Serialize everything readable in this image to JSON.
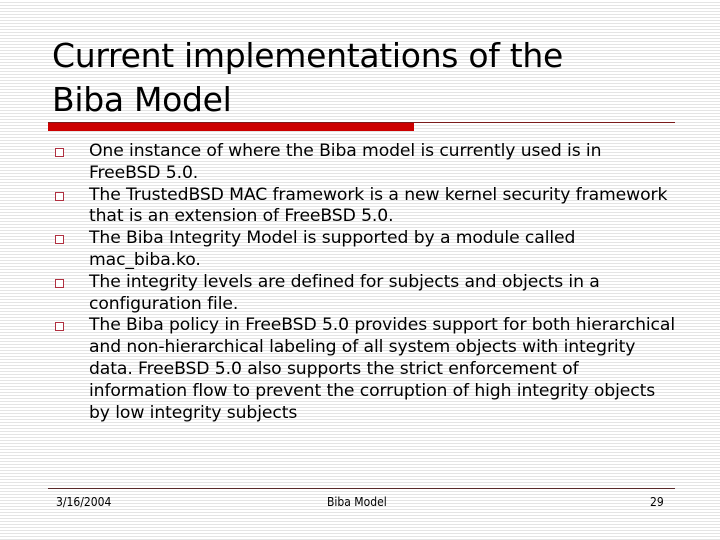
{
  "slide": {
    "title_line1": "Current implementations of the",
    "title_line2": "Biba Model",
    "bullets": [
      {
        "icon": "square-bullet-icon",
        "text": "One instance of where the Biba model is currently used is in FreeBSD 5.0."
      },
      {
        "icon": "square-bullet-icon",
        "text": "The TrustedBSD MAC framework is a new kernel security framework that is an extension of FreeBSD 5.0."
      },
      {
        "icon": "square-bullet-icon",
        "text": "The Biba Integrity Model is supported by a module called mac_biba.ko."
      },
      {
        "icon": "square-bullet-icon",
        "text": "The integrity levels are defined for subjects and objects in a configuration file."
      },
      {
        "icon": "square-bullet-icon",
        "text": "The Biba policy in FreeBSD 5.0 provides support for both hierarchical and non-hierarchical labeling of all system objects with integrity data.  FreeBSD 5.0 also supports the strict enforcement of information flow to prevent the corruption of high integrity objects by low integrity subjects"
      }
    ],
    "colors": {
      "accent": "#cc0000",
      "rule": "#7a1a1a",
      "bullet": "#b03040"
    }
  },
  "footer": {
    "date": "3/16/2004",
    "title": "Biba Model",
    "page": "29"
  }
}
